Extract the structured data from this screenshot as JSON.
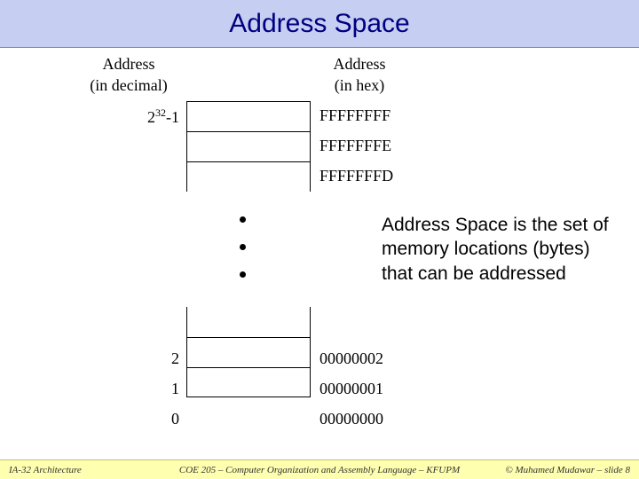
{
  "title": "Address Space",
  "headers": {
    "dec": "Address",
    "dec_sub": "(in decimal)",
    "hex": "Address",
    "hex_sub": "(in hex)"
  },
  "labels": {
    "top_dec_base": "2",
    "top_dec_exp": "32",
    "top_dec_suffix": "-1",
    "hex_top": "FFFFFFFF",
    "hex_r1": "FFFFFFFE",
    "hex_r2": "FFFFFFFD",
    "dec_b2": "2",
    "dec_b1": "1",
    "dec_b0": "0",
    "hex_b2": "00000002",
    "hex_b1": "00000001",
    "hex_b0": "00000000"
  },
  "annotation": "Address Space is the set of memory locations (bytes) that can be addressed",
  "footer": {
    "left": "IA-32 Architecture",
    "center": "COE 205 – Computer Organization and Assembly Language – KFUPM",
    "right": "© Muhamed Mudawar – slide 8"
  }
}
